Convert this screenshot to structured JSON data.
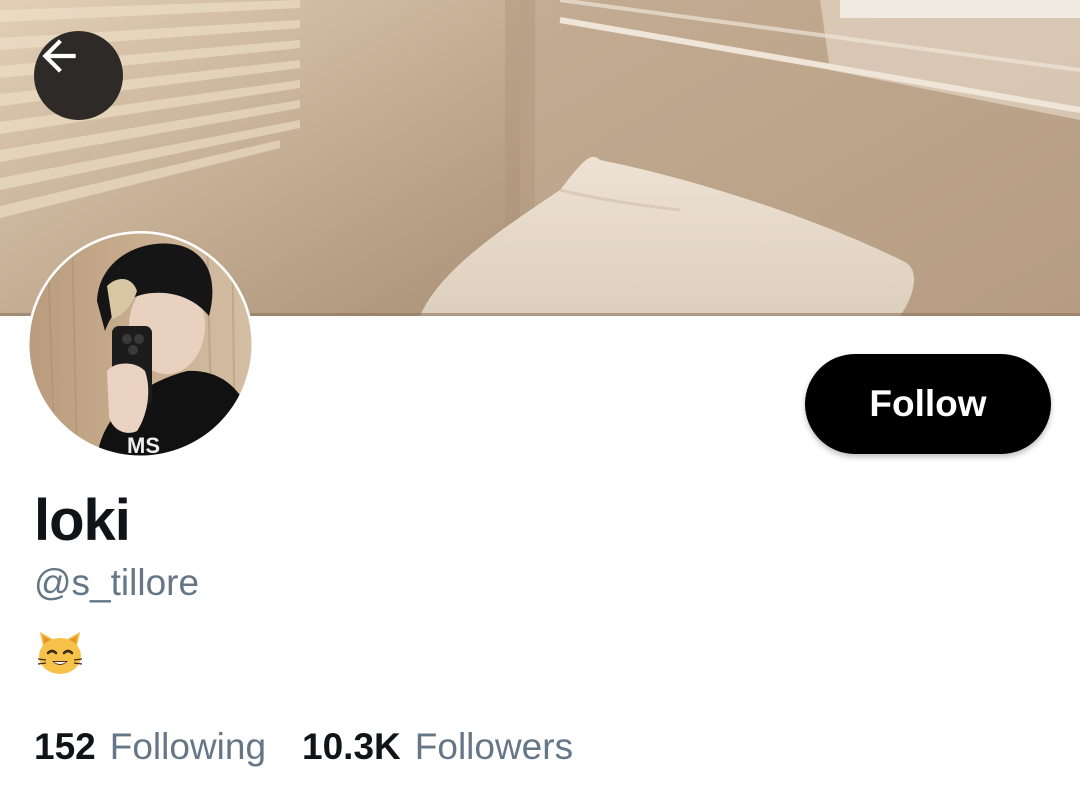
{
  "header": {
    "back_icon": "arrow-left-icon"
  },
  "profile": {
    "display_name": "loki",
    "handle": "@s_tillore",
    "bio_emoji": "grinning-cat-icon",
    "follow_label": "Follow"
  },
  "stats": {
    "following": {
      "count": "152",
      "label": "Following"
    },
    "followers": {
      "count": "10.3K",
      "label": "Followers"
    }
  },
  "colors": {
    "primary_text": "#0f1419",
    "secondary_text": "#657786",
    "follow_button_bg": "#000000",
    "follow_button_text": "#ffffff"
  }
}
